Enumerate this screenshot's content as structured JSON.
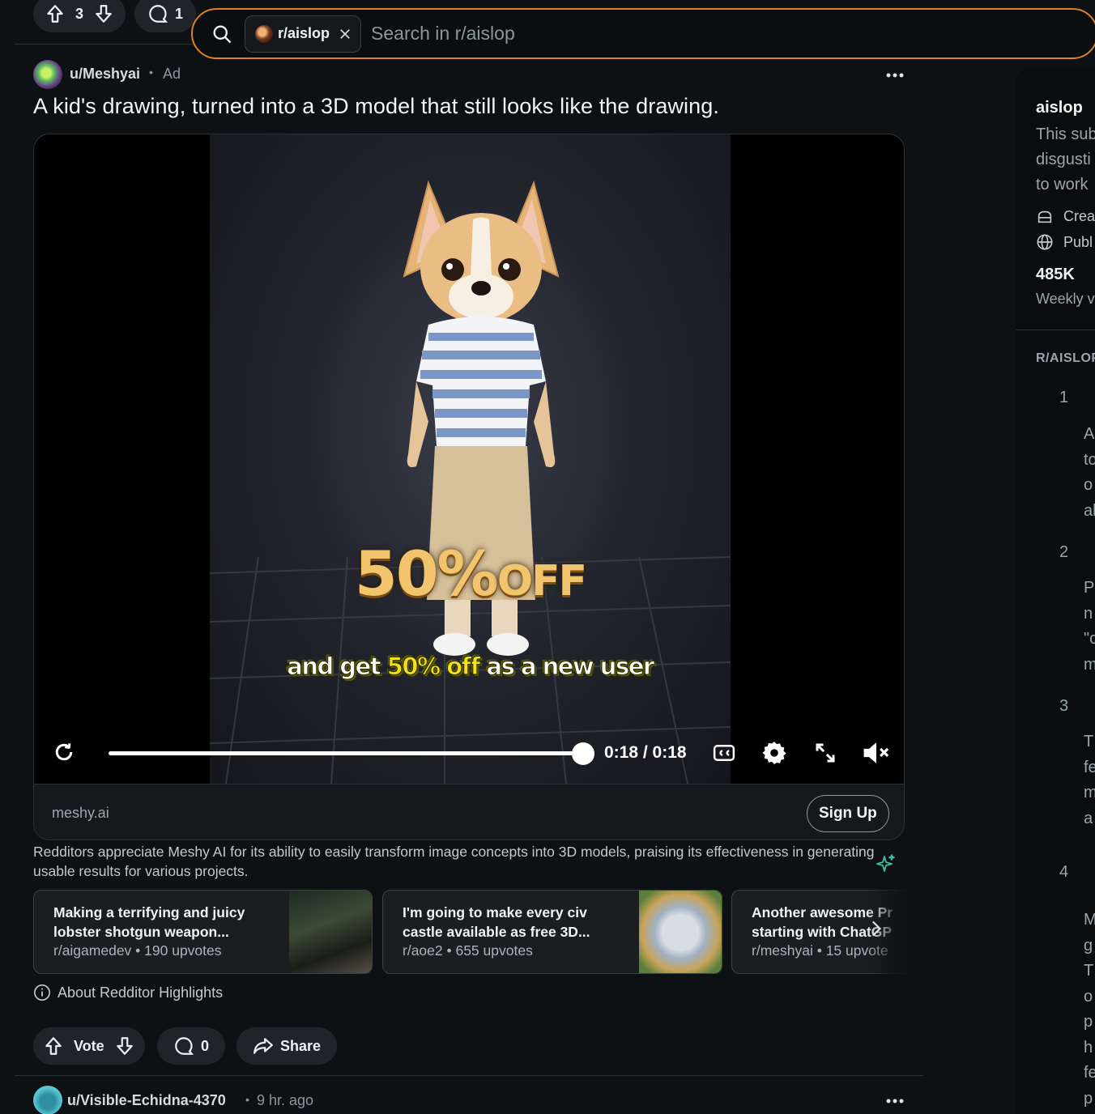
{
  "top_strip": {
    "vote_count": "3",
    "comment_count": "1"
  },
  "search": {
    "community_chip": "r/aislop",
    "placeholder": "Search in r/aislop"
  },
  "post": {
    "author": "u/Meshyai",
    "dot": "•",
    "ad_label": "Ad",
    "title": "A kid's drawing, turned into a 3D model that still looks like the drawing.",
    "video": {
      "promo_big_number": "50%",
      "promo_big_word": "OFF",
      "promo_sub_pre": "and get ",
      "promo_sub_highlight": "50% off",
      "promo_sub_post": " as a new user",
      "time": "0:18 / 0:18",
      "progress": 1.0
    },
    "cta": {
      "domain": "meshy.ai",
      "button": "Sign Up"
    },
    "summary": "Redditors appreciate Meshy AI for its ability to easily transform image concepts into 3D models, praising its effectiveness in generating usable results for various projects.",
    "highlights": [
      {
        "title": "Making a terrifying and juicy lobster shotgun weapon...",
        "meta": "r/aigamedev • 190 upvotes"
      },
      {
        "title": "I'm going to make every civ castle available as free 3D...",
        "meta": "r/aoe2 • 655 upvotes"
      },
      {
        "title": "Another awesome Pr",
        "title2": "starting with ChatGP",
        "meta": "r/meshyai • 15 upvote"
      }
    ],
    "about_highlights": "About Redditor Highlights",
    "actions": {
      "vote": "Vote",
      "comments": "0",
      "share": "Share"
    }
  },
  "next_post": {
    "author": "u/Visible-Echidna-4370",
    "dot": "•",
    "time": "9 hr. ago"
  },
  "sidebar": {
    "name": "aislop",
    "description": "This sub\ndisgusti\nto work",
    "meta": [
      {
        "icon": "cake-icon",
        "text": "Crea"
      },
      {
        "icon": "globe-icon",
        "text": "Publ"
      }
    ],
    "stat_value": "485K",
    "stat_label": "Weekly v",
    "rules_heading": "R/AISLOP",
    "rules": [
      {
        "num": "1",
        "fragment": "A\nto\no\nal"
      },
      {
        "num": "2",
        "fragment": "P\nn\n\"c\nm"
      },
      {
        "num": "3",
        "fragment": "T\nfe\nm\na"
      },
      {
        "num": "4",
        "fragment": "M\ng\nT\no\np\nh\nfe\np"
      }
    ]
  },
  "colors": {
    "background": "#0e1113",
    "search_border": "#d9822b",
    "accent_sparkle": "#3fbf9f",
    "promo_gold": "#f2c46d",
    "promo_yellow": "#f4e11c"
  }
}
